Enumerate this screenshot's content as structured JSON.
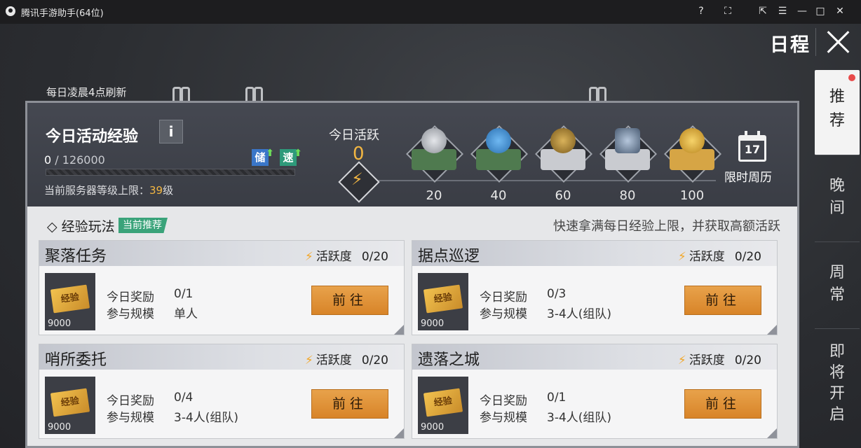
{
  "window": {
    "title": "腾讯手游助手(64位)",
    "buttons": [
      "?",
      "⛶",
      "⇱",
      "☰",
      "—",
      "□",
      "✕"
    ]
  },
  "header": {
    "title": "日程"
  },
  "right_tabs": [
    {
      "label": "推荐",
      "active": true,
      "has_dot": true
    },
    {
      "label": "晚间",
      "active": false
    },
    {
      "label": "周常",
      "active": false
    },
    {
      "label": "即将开启",
      "active": false
    }
  ],
  "refresh_note": "每日凌晨4点刷新",
  "exp": {
    "title": "今日活动经验",
    "info_glyph": "i",
    "current": "0",
    "separator": "/",
    "max": "126000",
    "store_badge": "储",
    "speed_badge": "速",
    "level_cap_prefix": "当前服务器等级上限：",
    "level_cap_value": "39",
    "level_cap_suffix": "级"
  },
  "activity": {
    "label": "今日活跃",
    "value": "0",
    "milestones": [
      {
        "value": "20",
        "icon": "silver-coin-chest-icon"
      },
      {
        "value": "40",
        "icon": "energy-chest-icon"
      },
      {
        "value": "60",
        "icon": "emblem-chest-icon"
      },
      {
        "value": "80",
        "icon": "armor-chest-icon"
      },
      {
        "value": "100",
        "icon": "gold-coin-chest-icon"
      }
    ]
  },
  "calendar": {
    "day": "17",
    "label": "限时周历"
  },
  "section": {
    "title": "◇ 经验玩法",
    "badge": "当前推荐",
    "hint": "快速拿满每日经验上限，并获取高额活跃"
  },
  "tasks": [
    {
      "name": "聚落任务",
      "activity_label": "活跃度",
      "activity_value": "0/20",
      "reward_label": "今日奖励",
      "reward_value": "0/1",
      "scale_label": "参与规模",
      "scale_value": "单人",
      "ticket_text": "经验",
      "ticket_amount": "9000",
      "button": "前往"
    },
    {
      "name": "据点巡逻",
      "activity_label": "活跃度",
      "activity_value": "0/20",
      "reward_label": "今日奖励",
      "reward_value": "0/3",
      "scale_label": "参与规模",
      "scale_value": "3-4人(组队)",
      "ticket_text": "经验",
      "ticket_amount": "9000",
      "button": "前往"
    },
    {
      "name": "哨所委托",
      "activity_label": "活跃度",
      "activity_value": "0/20",
      "reward_label": "今日奖励",
      "reward_value": "0/4",
      "scale_label": "参与规模",
      "scale_value": "3-4人(组队)",
      "ticket_text": "经验",
      "ticket_amount": "9000",
      "button": "前往"
    },
    {
      "name": "遗落之城",
      "activity_label": "活跃度",
      "activity_value": "0/20",
      "reward_label": "今日奖励",
      "reward_value": "0/1",
      "scale_label": "参与规模",
      "scale_value": "3-4人(组队)",
      "ticket_text": "经验",
      "ticket_amount": "9000",
      "button": "前往"
    }
  ],
  "colors": {
    "accent": "#f2b642",
    "button": "#e09436",
    "badge": "#3aa37a",
    "dot": "#e84a4a"
  }
}
